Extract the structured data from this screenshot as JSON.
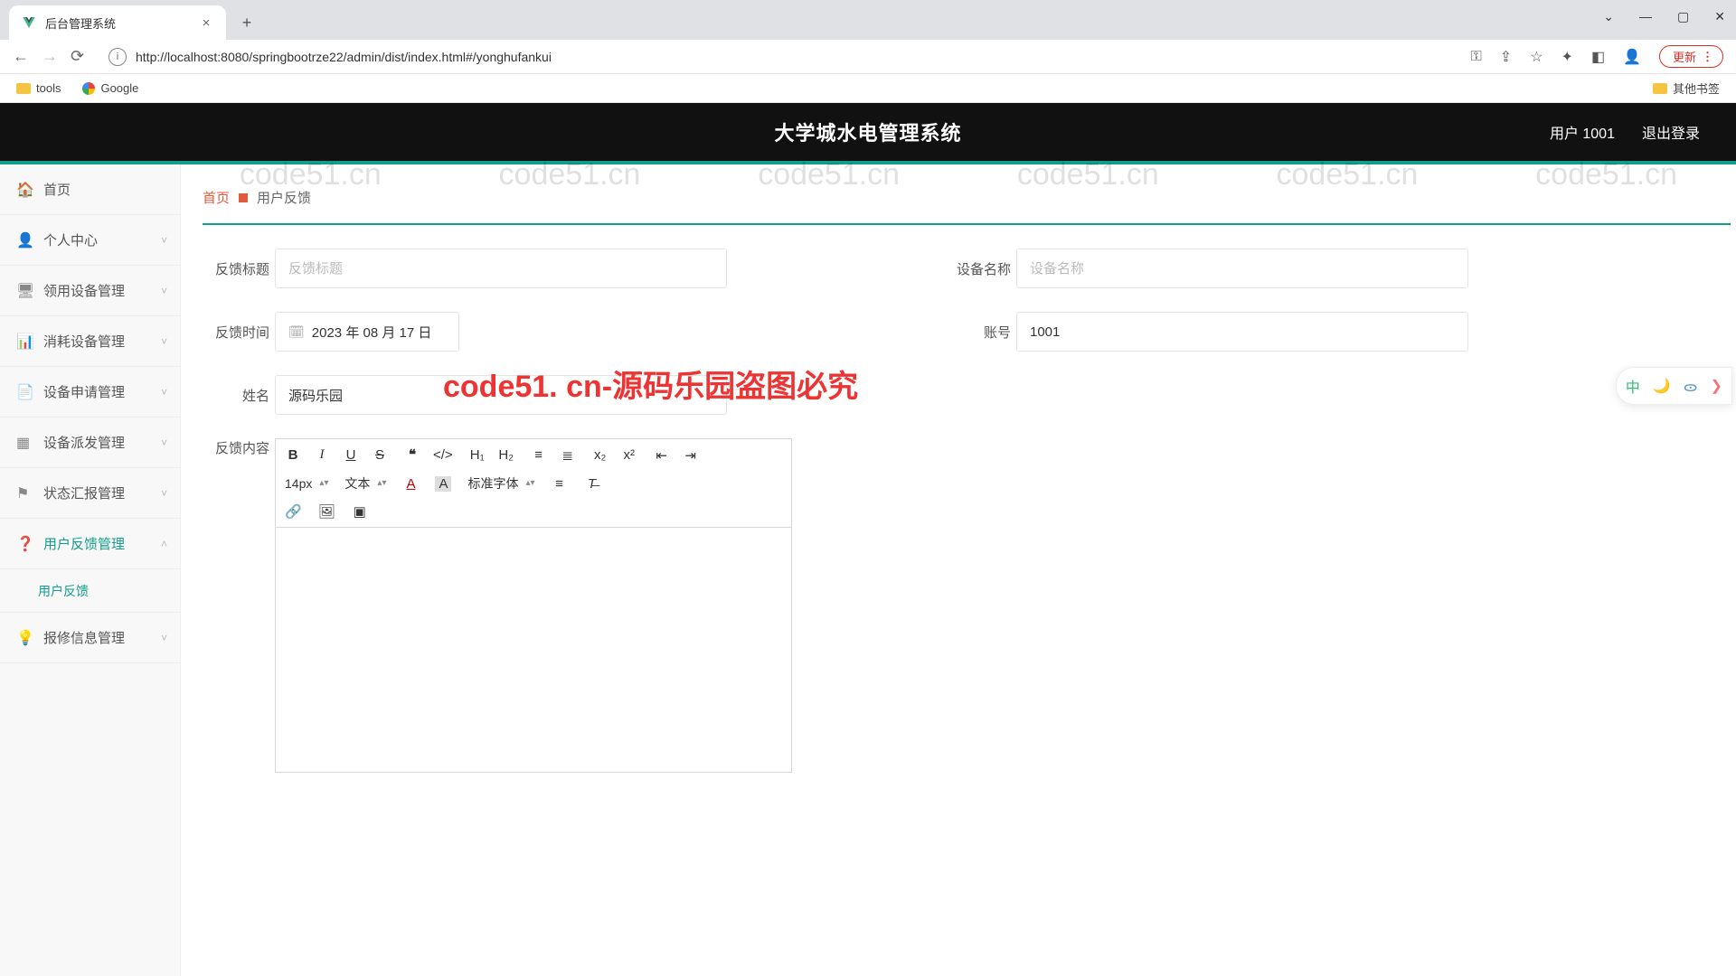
{
  "browser": {
    "tab_title": "后台管理系统",
    "url": "http://localhost:8080/springbootrze22/admin/dist/index.html#/yonghufankui",
    "update_label": "更新",
    "bookmarks": {
      "tools": "tools",
      "google": "Google",
      "other": "其他书签"
    }
  },
  "header": {
    "app_title": "大学城水电管理系统",
    "user_label": "用户 1001",
    "logout_label": "退出登录"
  },
  "sidebar": {
    "items": [
      {
        "label": "首页",
        "icon": "home",
        "expandable": false
      },
      {
        "label": "个人中心",
        "icon": "user",
        "expandable": true
      },
      {
        "label": "领用设备管理",
        "icon": "screen",
        "expandable": true
      },
      {
        "label": "消耗设备管理",
        "icon": "bars",
        "expandable": true
      },
      {
        "label": "设备申请管理",
        "icon": "note",
        "expandable": true
      },
      {
        "label": "设备派发管理",
        "icon": "grid",
        "expandable": true
      },
      {
        "label": "状态汇报管理",
        "icon": "flag",
        "expandable": true
      },
      {
        "label": "用户反馈管理",
        "icon": "help",
        "expandable": true,
        "active": true,
        "open": true
      },
      {
        "label": "报修信息管理",
        "icon": "bulb",
        "expandable": true
      }
    ],
    "sub_item": "用户反馈"
  },
  "breadcrumb": {
    "home": "首页",
    "current": "用户反馈"
  },
  "form": {
    "title_label": "反馈标题",
    "title_placeholder": "反馈标题",
    "device_label": "设备名称",
    "device_placeholder": "设备名称",
    "time_label": "反馈时间",
    "time_value": "2023 年 08 月 17 日",
    "account_label": "账号",
    "account_value": "1001",
    "name_label": "姓名",
    "name_value": "源码乐园",
    "content_label": "反馈内容"
  },
  "editor": {
    "font_size": "14px",
    "text_label": "文本",
    "font_family": "标准字体"
  },
  "floater": {
    "lang": "中"
  },
  "watermark": {
    "url": "code51.cn",
    "big": "code51. cn-源码乐园盗图必究"
  }
}
